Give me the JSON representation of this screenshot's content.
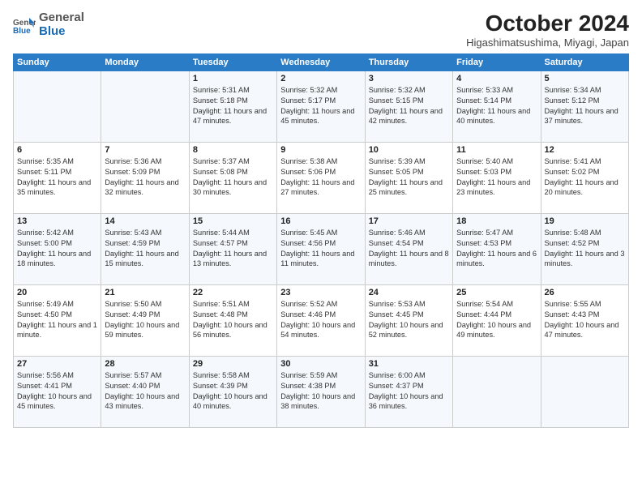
{
  "logo": {
    "general": "General",
    "blue": "Blue"
  },
  "header": {
    "month": "October 2024",
    "location": "Higashimatsushima, Miyagi, Japan"
  },
  "weekdays": [
    "Sunday",
    "Monday",
    "Tuesday",
    "Wednesday",
    "Thursday",
    "Friday",
    "Saturday"
  ],
  "weeks": [
    [
      {
        "day": "",
        "text": ""
      },
      {
        "day": "",
        "text": ""
      },
      {
        "day": "1",
        "text": "Sunrise: 5:31 AM\nSunset: 5:18 PM\nDaylight: 11 hours and 47 minutes."
      },
      {
        "day": "2",
        "text": "Sunrise: 5:32 AM\nSunset: 5:17 PM\nDaylight: 11 hours and 45 minutes."
      },
      {
        "day": "3",
        "text": "Sunrise: 5:32 AM\nSunset: 5:15 PM\nDaylight: 11 hours and 42 minutes."
      },
      {
        "day": "4",
        "text": "Sunrise: 5:33 AM\nSunset: 5:14 PM\nDaylight: 11 hours and 40 minutes."
      },
      {
        "day": "5",
        "text": "Sunrise: 5:34 AM\nSunset: 5:12 PM\nDaylight: 11 hours and 37 minutes."
      }
    ],
    [
      {
        "day": "6",
        "text": "Sunrise: 5:35 AM\nSunset: 5:11 PM\nDaylight: 11 hours and 35 minutes."
      },
      {
        "day": "7",
        "text": "Sunrise: 5:36 AM\nSunset: 5:09 PM\nDaylight: 11 hours and 32 minutes."
      },
      {
        "day": "8",
        "text": "Sunrise: 5:37 AM\nSunset: 5:08 PM\nDaylight: 11 hours and 30 minutes."
      },
      {
        "day": "9",
        "text": "Sunrise: 5:38 AM\nSunset: 5:06 PM\nDaylight: 11 hours and 27 minutes."
      },
      {
        "day": "10",
        "text": "Sunrise: 5:39 AM\nSunset: 5:05 PM\nDaylight: 11 hours and 25 minutes."
      },
      {
        "day": "11",
        "text": "Sunrise: 5:40 AM\nSunset: 5:03 PM\nDaylight: 11 hours and 23 minutes."
      },
      {
        "day": "12",
        "text": "Sunrise: 5:41 AM\nSunset: 5:02 PM\nDaylight: 11 hours and 20 minutes."
      }
    ],
    [
      {
        "day": "13",
        "text": "Sunrise: 5:42 AM\nSunset: 5:00 PM\nDaylight: 11 hours and 18 minutes."
      },
      {
        "day": "14",
        "text": "Sunrise: 5:43 AM\nSunset: 4:59 PM\nDaylight: 11 hours and 15 minutes."
      },
      {
        "day": "15",
        "text": "Sunrise: 5:44 AM\nSunset: 4:57 PM\nDaylight: 11 hours and 13 minutes."
      },
      {
        "day": "16",
        "text": "Sunrise: 5:45 AM\nSunset: 4:56 PM\nDaylight: 11 hours and 11 minutes."
      },
      {
        "day": "17",
        "text": "Sunrise: 5:46 AM\nSunset: 4:54 PM\nDaylight: 11 hours and 8 minutes."
      },
      {
        "day": "18",
        "text": "Sunrise: 5:47 AM\nSunset: 4:53 PM\nDaylight: 11 hours and 6 minutes."
      },
      {
        "day": "19",
        "text": "Sunrise: 5:48 AM\nSunset: 4:52 PM\nDaylight: 11 hours and 3 minutes."
      }
    ],
    [
      {
        "day": "20",
        "text": "Sunrise: 5:49 AM\nSunset: 4:50 PM\nDaylight: 11 hours and 1 minute."
      },
      {
        "day": "21",
        "text": "Sunrise: 5:50 AM\nSunset: 4:49 PM\nDaylight: 10 hours and 59 minutes."
      },
      {
        "day": "22",
        "text": "Sunrise: 5:51 AM\nSunset: 4:48 PM\nDaylight: 10 hours and 56 minutes."
      },
      {
        "day": "23",
        "text": "Sunrise: 5:52 AM\nSunset: 4:46 PM\nDaylight: 10 hours and 54 minutes."
      },
      {
        "day": "24",
        "text": "Sunrise: 5:53 AM\nSunset: 4:45 PM\nDaylight: 10 hours and 52 minutes."
      },
      {
        "day": "25",
        "text": "Sunrise: 5:54 AM\nSunset: 4:44 PM\nDaylight: 10 hours and 49 minutes."
      },
      {
        "day": "26",
        "text": "Sunrise: 5:55 AM\nSunset: 4:43 PM\nDaylight: 10 hours and 47 minutes."
      }
    ],
    [
      {
        "day": "27",
        "text": "Sunrise: 5:56 AM\nSunset: 4:41 PM\nDaylight: 10 hours and 45 minutes."
      },
      {
        "day": "28",
        "text": "Sunrise: 5:57 AM\nSunset: 4:40 PM\nDaylight: 10 hours and 43 minutes."
      },
      {
        "day": "29",
        "text": "Sunrise: 5:58 AM\nSunset: 4:39 PM\nDaylight: 10 hours and 40 minutes."
      },
      {
        "day": "30",
        "text": "Sunrise: 5:59 AM\nSunset: 4:38 PM\nDaylight: 10 hours and 38 minutes."
      },
      {
        "day": "31",
        "text": "Sunrise: 6:00 AM\nSunset: 4:37 PM\nDaylight: 10 hours and 36 minutes."
      },
      {
        "day": "",
        "text": ""
      },
      {
        "day": "",
        "text": ""
      }
    ]
  ]
}
